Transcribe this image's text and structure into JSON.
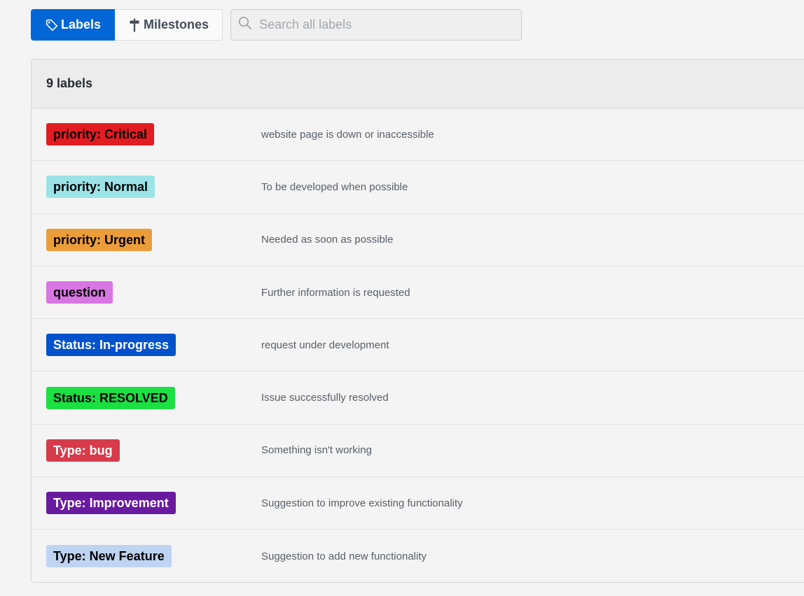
{
  "nav": {
    "labels_tab": "Labels",
    "milestones_tab": "Milestones",
    "search_placeholder": "Search all labels",
    "search_value": ""
  },
  "list": {
    "count_text": "9 labels",
    "labels": [
      {
        "name": "priority: Critical",
        "description": "website page is down or inaccessible",
        "bg": "#e11d21",
        "fg": "#000000"
      },
      {
        "name": "priority: Normal",
        "description": "To be developed when possible",
        "bg": "#9be3e6",
        "fg": "#000000"
      },
      {
        "name": "priority: Urgent",
        "description": "Needed as soon as possible",
        "bg": "#eb9d3a",
        "fg": "#000000"
      },
      {
        "name": "question",
        "description": "Further information is requested",
        "bg": "#d876e3",
        "fg": "#000000"
      },
      {
        "name": "Status: In-progress",
        "description": "request under development",
        "bg": "#0052cc",
        "fg": "#ffffff"
      },
      {
        "name": "Status: RESOLVED",
        "description": "Issue successfully resolved",
        "bg": "#1ae042",
        "fg": "#000000"
      },
      {
        "name": "Type: bug",
        "description": "Something isn't working",
        "bg": "#d73a4a",
        "fg": "#ffffff"
      },
      {
        "name": "Type: Improvement",
        "description": "Suggestion to improve existing functionality",
        "bg": "#6a1aa0",
        "fg": "#ffffff"
      },
      {
        "name": "Type: New Feature",
        "description": "Suggestion to add new functionality",
        "bg": "#bfd4f2",
        "fg": "#000000"
      }
    ]
  },
  "icons": {
    "labels_tab": "tag-icon",
    "milestones_tab": "milestone-icon",
    "search": "search-icon"
  }
}
